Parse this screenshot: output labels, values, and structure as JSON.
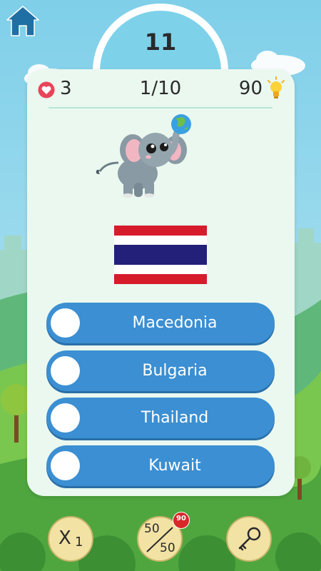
{
  "timer": {
    "value": "11"
  },
  "stats": {
    "lives": "3",
    "progress": "1/10",
    "hints": "90"
  },
  "quiz": {
    "flag_country": "Thailand",
    "answers": [
      {
        "label": "Macedonia"
      },
      {
        "label": "Bulgaria"
      },
      {
        "label": "Thailand"
      },
      {
        "label": "Kuwait"
      }
    ]
  },
  "powerups": {
    "multiplier": {
      "x": "X",
      "n": "1"
    },
    "fifty_fifty": {
      "top": "50",
      "bottom": "50",
      "cost_badge": "90"
    }
  },
  "icons": {
    "home": "home-icon",
    "heart": "heart-icon",
    "hint": "lightbulb-icon",
    "key": "key-icon",
    "mascot": "elephant-mascot"
  },
  "colors": {
    "sky": "#78c8e8",
    "answer_button": "#3b8fd2",
    "card": "#eaf8ef",
    "badge": "#d8282a",
    "powerup_button": "#f2e2a4"
  }
}
